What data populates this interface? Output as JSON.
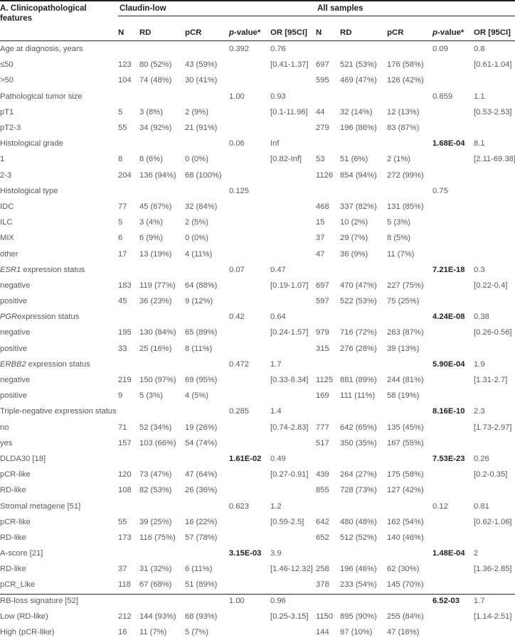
{
  "table": {
    "section_title": "A. Clinicopathological features",
    "groups": [
      {
        "name": "Claudin-low"
      },
      {
        "name": "All samples"
      }
    ],
    "columns": [
      "N",
      "RD",
      "pCR",
      "p-value*",
      "OR [95CI]",
      "N",
      "RD",
      "pCR",
      "p-value*",
      "OR [95CI]"
    ],
    "rows": [
      {
        "label": "Age at diagnosis, years",
        "label_style": "plain",
        "type": "header",
        "cl_n": "",
        "cl_rd": "",
        "cl_pcr": "",
        "cl_p": "0.392",
        "cl_p_bold": false,
        "cl_or": "0.76",
        "as_n": "",
        "as_rd": "",
        "as_pcr": "",
        "as_p": "0.09",
        "as_p_bold": false,
        "as_or": "0.8"
      },
      {
        "label": "≤50",
        "label_style": "plain",
        "type": "data",
        "cl_n": "123",
        "cl_rd": "80 (52%)",
        "cl_pcr": "43 (59%)",
        "cl_p": "",
        "cl_p_bold": false,
        "cl_or": "[0.41-1.37]",
        "as_n": "697",
        "as_rd": "521 (53%)",
        "as_pcr": "176 (58%)",
        "as_p": "",
        "as_p_bold": false,
        "as_or": "[0.61-1.04]"
      },
      {
        "label": ">50",
        "label_style": "plain",
        "type": "data",
        "cl_n": "104",
        "cl_rd": "74 (48%)",
        "cl_pcr": "30 (41%)",
        "cl_p": "",
        "cl_p_bold": false,
        "cl_or": "",
        "as_n": "595",
        "as_rd": "469 (47%)",
        "as_pcr": "126 (42%)",
        "as_p": "",
        "as_p_bold": false,
        "as_or": ""
      },
      {
        "label": "Pathological tumor size",
        "label_style": "plain",
        "type": "header",
        "cl_n": "",
        "cl_rd": "",
        "cl_pcr": "",
        "cl_p": "1.00",
        "cl_p_bold": false,
        "cl_or": "0.93",
        "as_n": "",
        "as_rd": "",
        "as_pcr": "",
        "as_p": "0.859",
        "as_p_bold": false,
        "as_or": "1.1"
      },
      {
        "label": "pT1",
        "label_style": "plain",
        "type": "data",
        "cl_n": "5",
        "cl_rd": "3 (8%)",
        "cl_pcr": "2 (9%)",
        "cl_p": "",
        "cl_p_bold": false,
        "cl_or": "[0.1-11.96]",
        "as_n": "44",
        "as_rd": "32 (14%)",
        "as_pcr": "12 (13%)",
        "as_p": "",
        "as_p_bold": false,
        "as_or": "[0.53-2.53]"
      },
      {
        "label": "pT2-3",
        "label_style": "plain",
        "type": "data",
        "cl_n": "55",
        "cl_rd": "34 (92%)",
        "cl_pcr": "21 (91%)",
        "cl_p": "",
        "cl_p_bold": false,
        "cl_or": "",
        "as_n": "279",
        "as_rd": "196 (86%)",
        "as_pcr": "83 (87%)",
        "as_p": "",
        "as_p_bold": false,
        "as_or": ""
      },
      {
        "label": "Histological grade",
        "label_style": "plain",
        "type": "header",
        "cl_n": "",
        "cl_rd": "",
        "cl_pcr": "",
        "cl_p": "0.06",
        "cl_p_bold": false,
        "cl_or": "Inf",
        "as_n": "",
        "as_rd": "",
        "as_pcr": "",
        "as_p": "1.68E-04",
        "as_p_bold": true,
        "as_or": "8.1"
      },
      {
        "label": "1",
        "label_style": "plain",
        "type": "data",
        "cl_n": "8",
        "cl_rd": "8 (6%)",
        "cl_pcr": "0 (0%)",
        "cl_p": "",
        "cl_p_bold": false,
        "cl_or": "[0.82-Inf]",
        "as_n": "53",
        "as_rd": "51 (6%)",
        "as_pcr": "2 (1%)",
        "as_p": "",
        "as_p_bold": false,
        "as_or": "[2.11-69.38]"
      },
      {
        "label": "2-3",
        "label_style": "plain",
        "type": "data",
        "cl_n": "204",
        "cl_rd": "136 (94%)",
        "cl_pcr": "68 (100%)",
        "cl_p": "",
        "cl_p_bold": false,
        "cl_or": "",
        "as_n": "1126",
        "as_rd": "854 (94%)",
        "as_pcr": "272 (99%)",
        "as_p": "",
        "as_p_bold": false,
        "as_or": ""
      },
      {
        "label": "Histological type",
        "label_style": "plain",
        "type": "header",
        "cl_n": "",
        "cl_rd": "",
        "cl_pcr": "",
        "cl_p": "0.125",
        "cl_p_bold": false,
        "cl_or": "",
        "as_n": "",
        "as_rd": "",
        "as_pcr": "",
        "as_p": "0.75",
        "as_p_bold": false,
        "as_or": ""
      },
      {
        "label": "IDC",
        "label_style": "plain",
        "type": "data",
        "cl_n": "77",
        "cl_rd": "45 (67%)",
        "cl_pcr": "32 (84%)",
        "cl_p": "",
        "cl_p_bold": false,
        "cl_or": "",
        "as_n": "468",
        "as_rd": "337 (82%)",
        "as_pcr": "131 (85%)",
        "as_p": "",
        "as_p_bold": false,
        "as_or": ""
      },
      {
        "label": "ILC",
        "label_style": "plain",
        "type": "data",
        "cl_n": "5",
        "cl_rd": "3 (4%)",
        "cl_pcr": "2 (5%)",
        "cl_p": "",
        "cl_p_bold": false,
        "cl_or": "",
        "as_n": "15",
        "as_rd": "10 (2%)",
        "as_pcr": "5 (3%)",
        "as_p": "",
        "as_p_bold": false,
        "as_or": ""
      },
      {
        "label": "MIX",
        "label_style": "plain",
        "type": "data",
        "cl_n": "6",
        "cl_rd": "6 (9%)",
        "cl_pcr": "0 (0%)",
        "cl_p": "",
        "cl_p_bold": false,
        "cl_or": "",
        "as_n": "37",
        "as_rd": "29 (7%)",
        "as_pcr": "8 (5%)",
        "as_p": "",
        "as_p_bold": false,
        "as_or": ""
      },
      {
        "label": "other",
        "label_style": "plain",
        "type": "data",
        "cl_n": "17",
        "cl_rd": "13 (19%)",
        "cl_pcr": "4 (11%)",
        "cl_p": "",
        "cl_p_bold": false,
        "cl_or": "",
        "as_n": "47",
        "as_rd": "36 (9%)",
        "as_pcr": "11 (7%)",
        "as_p": "",
        "as_p_bold": false,
        "as_or": ""
      },
      {
        "label": "ESR1 expression status",
        "label_style": "italic-lead",
        "label_italic_part": "ESR1",
        "label_rest": " expression status",
        "type": "header",
        "cl_n": "",
        "cl_rd": "",
        "cl_pcr": "",
        "cl_p": "0.07",
        "cl_p_bold": false,
        "cl_or": "0.47",
        "as_n": "",
        "as_rd": "",
        "as_pcr": "",
        "as_p": "7.21E-18",
        "as_p_bold": true,
        "as_or": "0.3"
      },
      {
        "label": "negative",
        "label_style": "plain",
        "type": "data",
        "cl_n": "183",
        "cl_rd": "119 (77%)",
        "cl_pcr": "64 (88%)",
        "cl_p": "",
        "cl_p_bold": false,
        "cl_or": "[0.19-1.07]",
        "as_n": "697",
        "as_rd": "470 (47%)",
        "as_pcr": "227 (75%)",
        "as_p": "",
        "as_p_bold": false,
        "as_or": "[0.22-0.4]"
      },
      {
        "label": "positive",
        "label_style": "plain",
        "type": "data",
        "cl_n": "45",
        "cl_rd": "36 (23%)",
        "cl_pcr": "9 (12%)",
        "cl_p": "",
        "cl_p_bold": false,
        "cl_or": "",
        "as_n": "597",
        "as_rd": "522 (53%)",
        "as_pcr": "75 (25%)",
        "as_p": "",
        "as_p_bold": false,
        "as_or": ""
      },
      {
        "label": "PGRexpression status",
        "label_style": "italic-lead",
        "label_italic_part": "PGR",
        "label_rest": "expression status",
        "type": "header",
        "cl_n": "",
        "cl_rd": "",
        "cl_pcr": "",
        "cl_p": "0.42",
        "cl_p_bold": false,
        "cl_or": "0.64",
        "as_n": "",
        "as_rd": "",
        "as_pcr": "",
        "as_p": "4.24E-08",
        "as_p_bold": true,
        "as_or": "0.38"
      },
      {
        "label": "negative",
        "label_style": "plain",
        "type": "data",
        "cl_n": "195",
        "cl_rd": "130 (84%)",
        "cl_pcr": "65 (89%)",
        "cl_p": "",
        "cl_p_bold": false,
        "cl_or": "[0.24-1.57]",
        "as_n": "979",
        "as_rd": "716 (72%)",
        "as_pcr": "263 (87%)",
        "as_p": "",
        "as_p_bold": false,
        "as_or": "[0.26-0.56]"
      },
      {
        "label": "positive",
        "label_style": "plain",
        "type": "data",
        "cl_n": "33",
        "cl_rd": "25 (16%)",
        "cl_pcr": "8 (11%)",
        "cl_p": "",
        "cl_p_bold": false,
        "cl_or": "",
        "as_n": "315",
        "as_rd": "276 (28%)",
        "as_pcr": "39 (13%)",
        "as_p": "",
        "as_p_bold": false,
        "as_or": ""
      },
      {
        "label": "ERBB2 expression status",
        "label_style": "italic-lead",
        "label_italic_part": "ERBB2",
        "label_rest": " expression status",
        "type": "header",
        "cl_n": "",
        "cl_rd": "",
        "cl_pcr": "",
        "cl_p": "0.472",
        "cl_p_bold": false,
        "cl_or": "1.7",
        "as_n": "",
        "as_rd": "",
        "as_pcr": "",
        "as_p": "5.90E-04",
        "as_p_bold": true,
        "as_or": "1.9"
      },
      {
        "label": "negative",
        "label_style": "plain",
        "type": "data",
        "cl_n": "219",
        "cl_rd": "150 (97%)",
        "cl_pcr": "69 (95%)",
        "cl_p": "",
        "cl_p_bold": false,
        "cl_or": "[0.33-8.34]",
        "as_n": "1125",
        "as_rd": "881 (89%)",
        "as_pcr": "244 (81%)",
        "as_p": "",
        "as_p_bold": false,
        "as_or": "[1.31-2.7]"
      },
      {
        "label": "positive",
        "label_style": "plain",
        "type": "data",
        "cl_n": "9",
        "cl_rd": "5 (3%)",
        "cl_pcr": "4 (5%)",
        "cl_p": "",
        "cl_p_bold": false,
        "cl_or": "",
        "as_n": "169",
        "as_rd": "111 (11%)",
        "as_pcr": "58 (19%)",
        "as_p": "",
        "as_p_bold": false,
        "as_or": ""
      },
      {
        "label": "Triple-negative expression status",
        "label_style": "plain",
        "type": "header",
        "cl_n": "",
        "cl_rd": "",
        "cl_pcr": "",
        "cl_p": "0.285",
        "cl_p_bold": false,
        "cl_or": "1.4",
        "as_n": "",
        "as_rd": "",
        "as_pcr": "",
        "as_p": "8.16E-10",
        "as_p_bold": true,
        "as_or": "2.3"
      },
      {
        "label": "no",
        "label_style": "plain",
        "type": "data",
        "cl_n": "71",
        "cl_rd": "52 (34%)",
        "cl_pcr": "19 (26%)",
        "cl_p": "",
        "cl_p_bold": false,
        "cl_or": "[0.74-2.83]",
        "as_n": "777",
        "as_rd": "642 (65%)",
        "as_pcr": "135 (45%)",
        "as_p": "",
        "as_p_bold": false,
        "as_or": "[1.73-2.97]"
      },
      {
        "label": "yes",
        "label_style": "plain",
        "type": "data",
        "cl_n": "157",
        "cl_rd": "103 (66%)",
        "cl_pcr": "54 (74%)",
        "cl_p": "",
        "cl_p_bold": false,
        "cl_or": "",
        "as_n": "517",
        "as_rd": "350 (35%)",
        "as_pcr": "167 (55%)",
        "as_p": "",
        "as_p_bold": false,
        "as_or": ""
      },
      {
        "label": "DLDA30 [18]",
        "label_style": "plain",
        "type": "header",
        "cl_n": "",
        "cl_rd": "",
        "cl_pcr": "",
        "cl_p": "1.61E-02",
        "cl_p_bold": true,
        "cl_or": "0.49",
        "as_n": "",
        "as_rd": "",
        "as_pcr": "",
        "as_p": "7.53E-23",
        "as_p_bold": true,
        "as_or": "0.26"
      },
      {
        "label": "pCR-like",
        "label_style": "plain",
        "type": "data",
        "cl_n": "120",
        "cl_rd": "73 (47%)",
        "cl_pcr": "47 (64%)",
        "cl_p": "",
        "cl_p_bold": false,
        "cl_or": "[0.27-0.91]",
        "as_n": "439",
        "as_rd": "264 (27%)",
        "as_pcr": "175 (58%)",
        "as_p": "",
        "as_p_bold": false,
        "as_or": "[0.2-0.35]"
      },
      {
        "label": "RD-like",
        "label_style": "plain",
        "type": "data",
        "cl_n": "108",
        "cl_rd": "82 (53%)",
        "cl_pcr": "26 (36%)",
        "cl_p": "",
        "cl_p_bold": false,
        "cl_or": "",
        "as_n": "855",
        "as_rd": "728 (73%)",
        "as_pcr": "127 (42%)",
        "as_p": "",
        "as_p_bold": false,
        "as_or": ""
      },
      {
        "label": "Stromal metagene [51]",
        "label_style": "plain",
        "type": "header",
        "cl_n": "",
        "cl_rd": "",
        "cl_pcr": "",
        "cl_p": "0.623",
        "cl_p_bold": false,
        "cl_or": "1.2",
        "as_n": "",
        "as_rd": "",
        "as_pcr": "",
        "as_p": "0.12",
        "as_p_bold": false,
        "as_or": "0.81"
      },
      {
        "label": "pCR-like",
        "label_style": "plain",
        "type": "data",
        "cl_n": "55",
        "cl_rd": "39 (25%)",
        "cl_pcr": "16 (22%)",
        "cl_p": "",
        "cl_p_bold": false,
        "cl_or": "[0.59-2.5]",
        "as_n": "642",
        "as_rd": "480 (48%)",
        "as_pcr": "162 (54%)",
        "as_p": "",
        "as_p_bold": false,
        "as_or": "[0.62-1.06]"
      },
      {
        "label": "RD-like",
        "label_style": "plain",
        "type": "data",
        "cl_n": "173",
        "cl_rd": "116 (75%)",
        "cl_pcr": "57 (78%)",
        "cl_p": "",
        "cl_p_bold": false,
        "cl_or": "",
        "as_n": "652",
        "as_rd": "512 (52%)",
        "as_pcr": "140 (46%)",
        "as_p": "",
        "as_p_bold": false,
        "as_or": ""
      },
      {
        "label": "A-score [21]",
        "label_style": "plain",
        "type": "header",
        "cl_n": "",
        "cl_rd": "",
        "cl_pcr": "",
        "cl_p": "3.15E-03",
        "cl_p_bold": true,
        "cl_or": "3.9",
        "as_n": "",
        "as_rd": "",
        "as_pcr": "",
        "as_p": "1.48E-04",
        "as_p_bold": true,
        "as_or": "2"
      },
      {
        "label": "RD-like",
        "label_style": "plain",
        "type": "data",
        "cl_n": "37",
        "cl_rd": "31 (32%)",
        "cl_pcr": "6 (11%)",
        "cl_p": "",
        "cl_p_bold": false,
        "cl_or": "[1.46-12.32]",
        "as_n": "258",
        "as_rd": "196 (46%)",
        "as_pcr": "62 (30%)",
        "as_p": "",
        "as_p_bold": false,
        "as_or": "[1.36-2.85]"
      },
      {
        "label": "pCR_Like",
        "label_style": "plain",
        "type": "data",
        "cl_n": "118",
        "cl_rd": "67 (68%)",
        "cl_pcr": "51 (89%)",
        "cl_p": "",
        "cl_p_bold": false,
        "cl_or": "",
        "as_n": "378",
        "as_rd": "233 (54%)",
        "as_pcr": "145 (70%)",
        "as_p": "",
        "as_p_bold": false,
        "as_or": ""
      },
      {
        "label": "RB-loss signature [52]",
        "label_style": "plain",
        "type": "header",
        "cl_n": "",
        "cl_rd": "",
        "cl_pcr": "",
        "cl_p": "1.00",
        "cl_p_bold": false,
        "cl_or": "0.96",
        "as_n": "",
        "as_rd": "",
        "as_pcr": "",
        "as_p": "6.52-03",
        "as_p_bold": true,
        "as_or": "1.7"
      },
      {
        "label": "Low (RD-like)",
        "label_style": "plain",
        "type": "data",
        "cl_n": "212",
        "cl_rd": "144 (93%)",
        "cl_pcr": "68 (93%)",
        "cl_p": "",
        "cl_p_bold": false,
        "cl_or": "[0.25-3.15]",
        "as_n": "1150",
        "as_rd": "895 (90%)",
        "as_pcr": "255 (84%)",
        "as_p": "",
        "as_p_bold": false,
        "as_or": "[1.14-2.51]"
      },
      {
        "label": "High (pCR-like)",
        "label_style": "plain",
        "type": "data",
        "cl_n": "16",
        "cl_rd": "11 (7%)",
        "cl_pcr": "5 (7%)",
        "cl_p": "",
        "cl_p_bold": false,
        "cl_or": "",
        "as_n": "144",
        "as_rd": "97 (10%)",
        "as_pcr": "47 (16%)",
        "as_p": "",
        "as_p_bold": false,
        "as_or": ""
      }
    ]
  }
}
